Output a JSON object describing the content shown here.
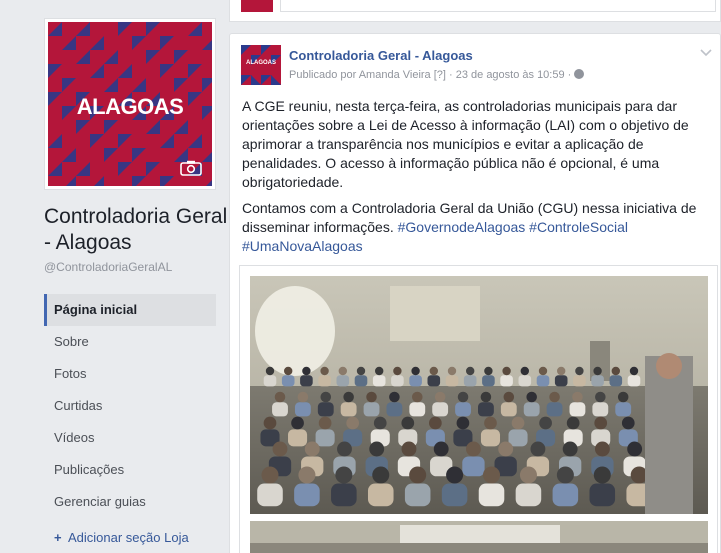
{
  "page": {
    "cover_word": "ALAGOAS",
    "name": "Controladoria Geral - Alagoas",
    "handle": "@ControladoriaGeralAL"
  },
  "nav": {
    "items": [
      {
        "label": "Página inicial",
        "active": true
      },
      {
        "label": "Sobre"
      },
      {
        "label": "Fotos"
      },
      {
        "label": "Curtidas"
      },
      {
        "label": "Vídeos"
      },
      {
        "label": "Publicações"
      },
      {
        "label": "Gerenciar guias"
      }
    ],
    "add_shop": "Adicionar seção Loja"
  },
  "post": {
    "avatar_word": "ALAGOAS",
    "author": "Controladoria Geral - Alagoas",
    "meta": "Publicado por Amanda Vieira [?] · 23 de agosto às 10:59 ·",
    "paragraph1": "A CGE reuniu, nesta terça-feira, as controladorias municipais para dar orientações sobre a Lei de Acesso à informação (LAI) com o objetivo de aprimorar a transparência nos municípios e evitar a aplicação de penalidades. O acesso à informação pública não é opcional, é uma obrigatoriedade.",
    "paragraph2": "Contamos com a Controladoria Geral da União (CGU) nessa iniciativa de disseminar informações.",
    "hashtags": [
      "#GovernodeAlagoas",
      "#ControleSocial",
      "#UmaNovaAlagoas"
    ]
  },
  "colors": {
    "brand_red": "#b4163a",
    "brand_blue": "#2b3a8c",
    "link": "#365899",
    "active_bar": "#4267b2"
  }
}
